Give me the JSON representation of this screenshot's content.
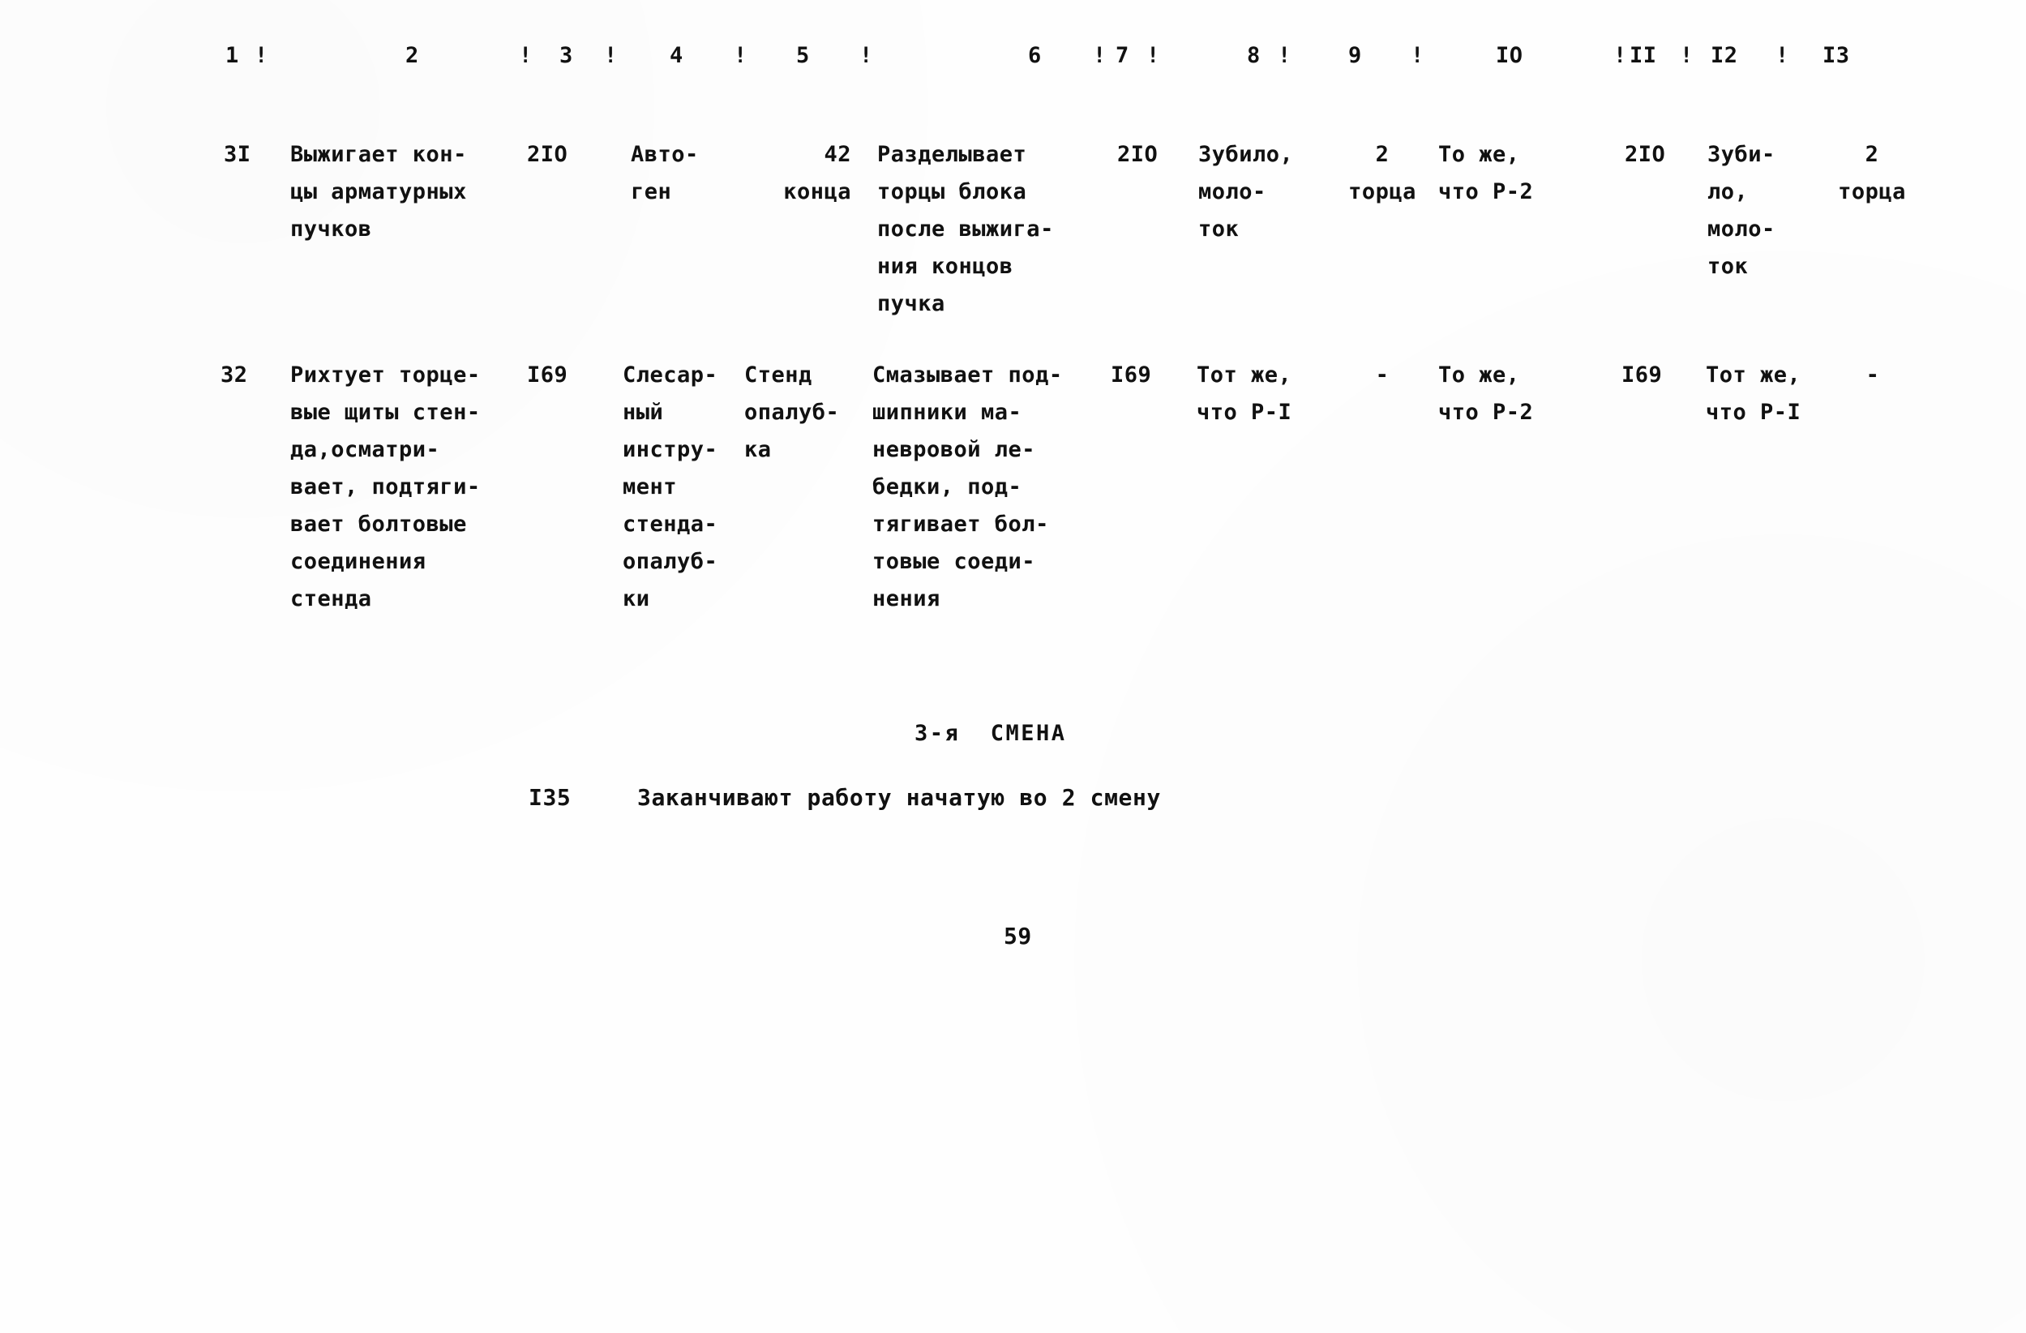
{
  "document": {
    "page_number": "59",
    "table": {
      "column_headers": [
        {
          "label": "1",
          "sep_before": "",
          "sep_after": "!"
        },
        {
          "label": "2",
          "sep_before": "",
          "sep_after": "!"
        },
        {
          "label": "3",
          "sep_before": "",
          "sep_after": "!"
        },
        {
          "label": "4",
          "sep_before": "",
          "sep_after": "!"
        },
        {
          "label": "5",
          "sep_before": "",
          "sep_after": "!"
        },
        {
          "label": "6",
          "sep_before": "",
          "sep_after": "!"
        },
        {
          "label": "7",
          "sep_before": "",
          "sep_after": "!"
        },
        {
          "label": "8",
          "sep_before": "",
          "sep_after": "!"
        },
        {
          "label": "9",
          "sep_before": "",
          "sep_after": "!"
        },
        {
          "label": "IO",
          "sep_before": "",
          "sep_after": "!"
        },
        {
          "label": "II",
          "sep_before": "!",
          "sep_after": "!"
        },
        {
          "label": "I2",
          "sep_before": "",
          "sep_after": "!"
        },
        {
          "label": "I3",
          "sep_before": "",
          "sep_after": ""
        }
      ],
      "header_sep_1": "!",
      "header_sep_2": "!",
      "header_sep_3": "!",
      "header_sep_4": "!",
      "header_sep_5": "!",
      "header_sep_6": "!",
      "header_sep_7": "!",
      "header_sep_8": "!",
      "header_sep_9": "!",
      "header_sep_10": "!",
      "header_sep_11": "!",
      "header_sep_12": "!",
      "rows": [
        {
          "num": "3I",
          "c2": "Выжигает кон-\nцы арматурных\nпучков",
          "c3": "2IO",
          "c4": "Авто-\nген",
          "c5": "42\nконца",
          "c6": "Разделывает\nторцы блока\nпосле выжига-\nния концов\nпучка",
          "c7": "2IO",
          "c8": "Зубило,\nмоло-\nток",
          "c9": "2\nторца",
          "c10": "То же,\nчто Р-2",
          "c11": "2IO",
          "c12": "Зуби-\nло,\nмоло-\nток",
          "c13": "2\nторца"
        },
        {
          "num": "32",
          "c2": "Рихтует торце-\nвые щиты стен-\nда,осматри-\nвает, подтяги-\nвает болтовые\nсоединения\nстенда",
          "c3": "I69",
          "c4": "Слесар-\nный\nинстру-\nмент\nстенда-\nопалуб-\nки",
          "c5": "Стенд\nопалуб-\nка",
          "c6": "Смазывает под-\nшипники ма-\nневровой ле-\nбедки, под-\nтягивает бол-\nтовые соеди-\nнения",
          "c7": "I69",
          "c8": "Тот же,\nчто Р-I",
          "c9": "-",
          "c10": "То же,\nчто Р-2",
          "c11": "I69",
          "c12": "Тот же,\nчто Р-I",
          "c13": "-"
        }
      ]
    },
    "shift_section": {
      "title": "3-я  СМЕНА",
      "entry_number": "I35",
      "entry_text": "Заканчивают работу начатую во 2 смену"
    }
  }
}
